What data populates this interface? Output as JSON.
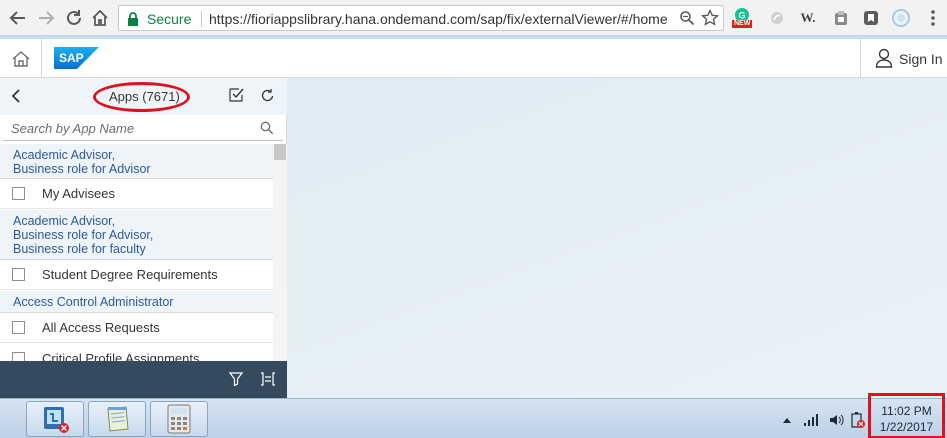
{
  "browser": {
    "secure_label": "Secure",
    "url": "https://fioriappslibrary.hana.ondemand.com/sap/fix/externalViewer/#/home",
    "extension_new_badge": "NEW",
    "extension_w_label": "W."
  },
  "shell": {
    "logo_text": "SAP",
    "signin_label": "Sign In"
  },
  "panel": {
    "title": "Apps (7671)",
    "search_placeholder": "Search by App Name",
    "groups": [
      {
        "lines": [
          "Academic Advisor,",
          "Business role for Advisor"
        ],
        "apps": [
          "My Advisees"
        ]
      },
      {
        "lines": [
          "Academic Advisor,",
          "Business role for Advisor,",
          "Business role for faculty"
        ],
        "apps": [
          "Student Degree Requirements"
        ]
      },
      {
        "lines": [
          "Access Control Administrator"
        ],
        "apps": [
          "All Access Requests",
          "Critical Profile Assignments"
        ]
      }
    ]
  },
  "taskbar": {
    "clock_time": "11:02 PM",
    "clock_date": "1/22/2017"
  },
  "colors": {
    "annotation_red": "#e0101c",
    "link_blue": "#2b5a9c",
    "panel_footer": "#354a5f",
    "secure_green": "#0b8043"
  }
}
